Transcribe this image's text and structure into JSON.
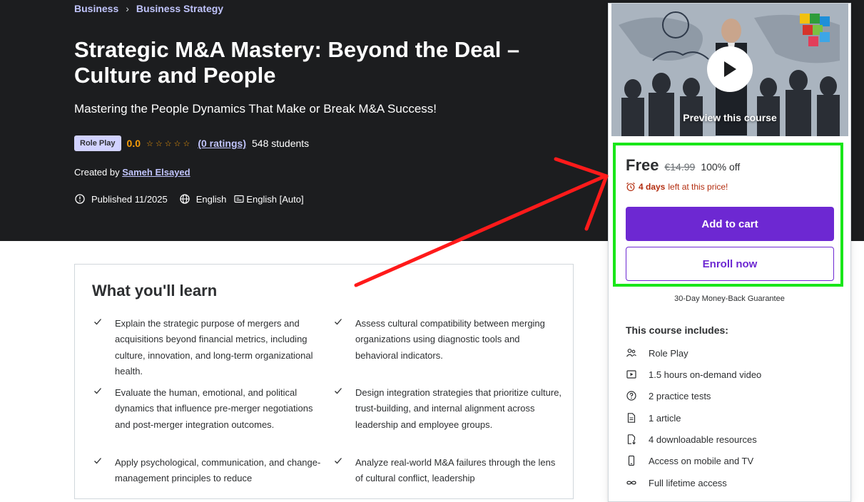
{
  "breadcrumb": {
    "items": [
      "Business",
      "Business Strategy"
    ]
  },
  "course": {
    "title": "Strategic M&A Mastery: Beyond the Deal – Culture and People",
    "subtitle": "Mastering the People Dynamics That Make or Break M&A Success!",
    "badge": "Role Play",
    "rating": "0.0",
    "stars": "☆☆☆☆☆",
    "ratings_count": "(0 ratings)",
    "students": "548 students",
    "created_by_label": "Created by",
    "author": "Sameh Elsayed",
    "published": "Published 11/2025",
    "language": "English",
    "captions": "English [Auto]"
  },
  "learn": {
    "title": "What you'll learn",
    "items": [
      "Explain the strategic purpose of mergers and acquisitions beyond financial metrics, including culture, innovation, and long-term organizational health.",
      "Assess cultural compatibility between merging organizations using diagnostic tools and behavioral indicators.",
      "Evaluate the human, emotional, and political dynamics that influence pre-merger negotiations and post-merger integration outcomes.",
      "Design integration strategies that prioritize culture, trust-building, and internal alignment across leadership and employee groups.",
      "Apply psychological, communication, and change-management principles to reduce",
      "Analyze real-world M&A failures through the lens of cultural conflict, leadership"
    ]
  },
  "sidebar": {
    "preview_label": "Preview this course",
    "price_now": "Free",
    "price_old": "€14.99",
    "discount": "100% off",
    "timer_bold": "4 days",
    "timer_rest": "left at this price!",
    "add_to_cart": "Add to cart",
    "enroll_now": "Enroll now",
    "guarantee": "30-Day Money-Back Guarantee",
    "includes_title": "This course includes:",
    "includes": [
      {
        "icon": "role-play-icon",
        "label": "Role Play"
      },
      {
        "icon": "video-icon",
        "label": "1.5 hours on-demand video"
      },
      {
        "icon": "question-icon",
        "label": "2 practice tests"
      },
      {
        "icon": "article-icon",
        "label": "1 article"
      },
      {
        "icon": "download-icon",
        "label": "4 downloadable resources"
      },
      {
        "icon": "mobile-icon",
        "label": "Access on mobile and TV"
      },
      {
        "icon": "infinity-icon",
        "label": "Full lifetime access"
      }
    ]
  },
  "colors": {
    "hero_bg": "#1c1d1f",
    "accent_purple": "#6d28d2",
    "link_lavender": "#c0c4fc",
    "star_orange": "#f69c08",
    "timer_red": "#b32d0f",
    "annotation_green": "#19e619",
    "annotation_red": "#ff1a1a"
  }
}
